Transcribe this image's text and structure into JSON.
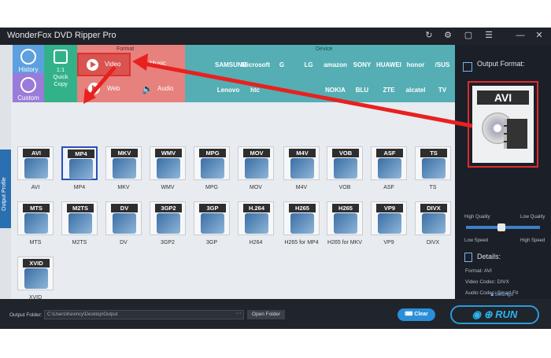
{
  "window": {
    "title": "WonderFox DVD Ripper Pro"
  },
  "titlebar_icons": [
    "refresh-icon",
    "gear-icon",
    "chat-icon",
    "menu-icon",
    "minimize-icon",
    "close-icon"
  ],
  "left_buttons": {
    "history": "History",
    "custom": "Custom",
    "quick_copy_line1": "1:1",
    "quick_copy_line2": "Quick",
    "quick_copy_line3": "Copy"
  },
  "format_band": {
    "label": "Format",
    "video": "Video",
    "music": "Music",
    "web": "Web",
    "audio": "Audio"
  },
  "device_band": {
    "label": "Device",
    "brands_top": [
      "",
      "SAMSUNG",
      "Microsoft",
      "G",
      "LG",
      "amazon",
      "SONY",
      "HUAWEI",
      "honor",
      "/SUS"
    ],
    "brands_bottom": [
      "",
      "Lenovo",
      "htc",
      "",
      "",
      "NOKIA",
      "BLU",
      "ZTE",
      "alcatel",
      "TV"
    ]
  },
  "sidebar_tab": "Output Profile",
  "formats": [
    {
      "tag": "AVI",
      "name": "AVI"
    },
    {
      "tag": "MP4",
      "name": "MP4"
    },
    {
      "tag": "MKV",
      "name": "MKV"
    },
    {
      "tag": "WMV",
      "name": "WMV"
    },
    {
      "tag": "MPG",
      "name": "MPG"
    },
    {
      "tag": "MOV",
      "name": "MOV"
    },
    {
      "tag": "M4V",
      "name": "M4V"
    },
    {
      "tag": "VOB",
      "name": "VOB"
    },
    {
      "tag": "ASF",
      "name": "ASF"
    },
    {
      "tag": "TS",
      "name": "TS"
    },
    {
      "tag": "MTS",
      "name": "MTS"
    },
    {
      "tag": "M2TS",
      "name": "M2TS"
    },
    {
      "tag": "DV",
      "name": "DV"
    },
    {
      "tag": "3GP2",
      "name": "3GP2"
    },
    {
      "tag": "3GP",
      "name": "3GP"
    },
    {
      "tag": "H.264",
      "name": "H264"
    },
    {
      "tag": "H265",
      "name": "H265 for MP4"
    },
    {
      "tag": "H265",
      "name": "H265 for MKV"
    },
    {
      "tag": "VP9",
      "name": "VP9"
    },
    {
      "tag": "DIVX",
      "name": "DIVX"
    },
    {
      "tag": "XVID",
      "name": "XVID"
    }
  ],
  "right_panel": {
    "output_format_title": "Output Format:",
    "output_format_value": "AVI",
    "high_quality": "High Quality",
    "low_quality": "Low Quality",
    "low_speed": "Low Speed",
    "high_speed": "High Speed",
    "details_title": "Details:",
    "format_line": "Format: AVI",
    "video_codec_line": "Video Codec: DIVX",
    "audio_codec_line": "Audio Codec: Smart Fit",
    "settings": "▲Settings"
  },
  "bottom_bar": {
    "output_folder_label": "Output Folder:",
    "output_path": "C:\\Users\\Kevincy\\Desktop\\Output",
    "dots": "···",
    "open_folder": "Open Folder",
    "clear": "Clear",
    "run": "RUN"
  },
  "colors": {
    "accent_red": "#e02b2b",
    "format_band": "#e7817d",
    "device_band": "#54aeb4",
    "dark_panel": "#1b1f27",
    "run_blue": "#2a9bdc"
  }
}
